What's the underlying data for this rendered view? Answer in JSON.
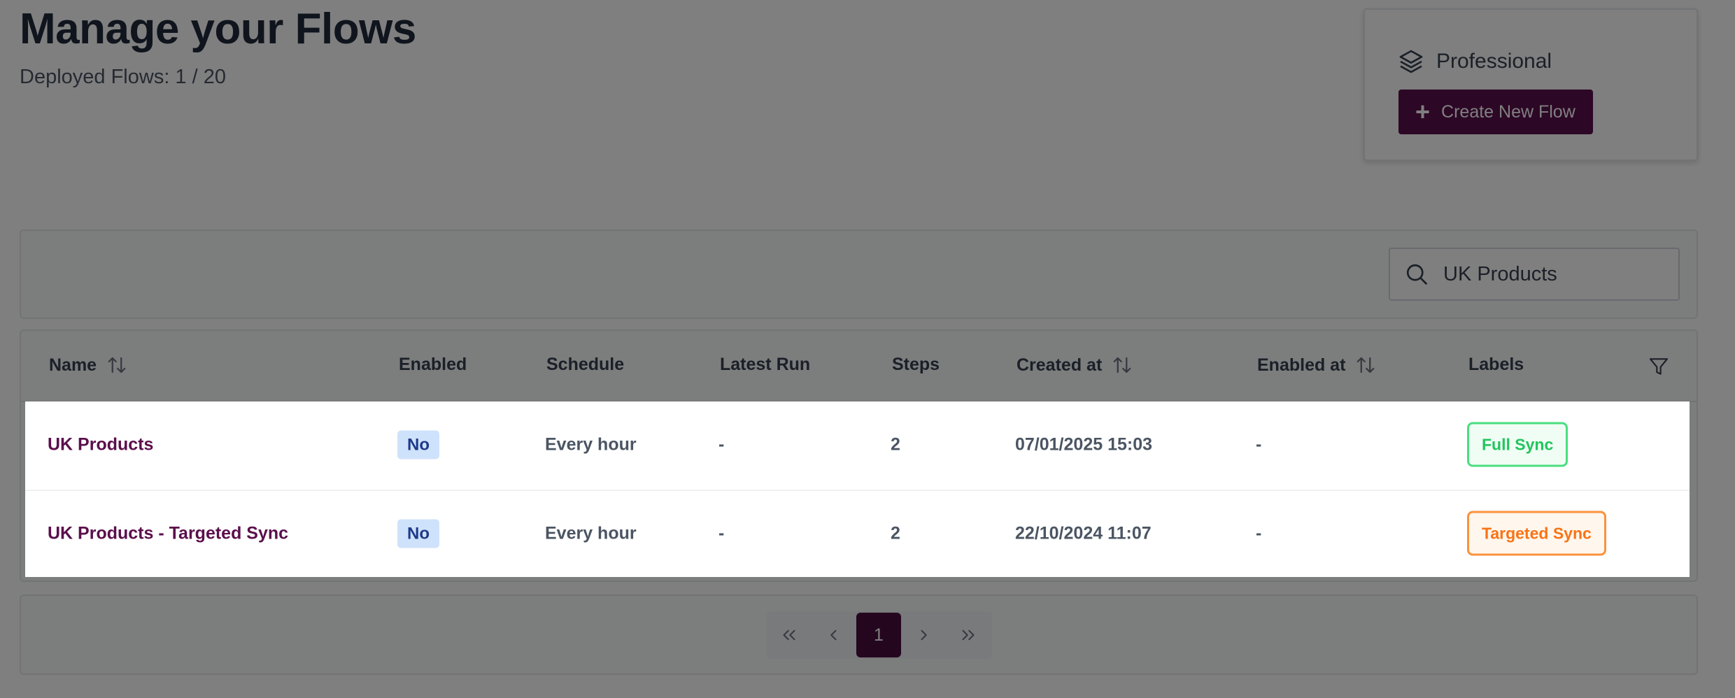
{
  "header": {
    "title": "Manage your Flows",
    "deployed": "Deployed Flows: 1 / 20"
  },
  "plan": {
    "icon": "layers-icon",
    "name": "Professional",
    "create_button": "Create New Flow"
  },
  "search": {
    "value": "UK Products",
    "icon": "search-icon"
  },
  "table": {
    "columns": [
      "Name",
      "Enabled",
      "Schedule",
      "Latest Run",
      "Steps",
      "Created at",
      "Enabled at",
      "Labels"
    ],
    "rows": [
      {
        "name": "UK Products",
        "enabled": "No",
        "schedule": "Every hour",
        "latest_run": "-",
        "steps": "2",
        "created_at": "07/01/2025 15:03",
        "enabled_at": "-",
        "label": "Full Sync"
      },
      {
        "name": "UK Products - Targeted Sync",
        "enabled": "No",
        "schedule": "Every hour",
        "latest_run": "-",
        "steps": "2",
        "created_at": "22/10/2024 11:07",
        "enabled_at": "-",
        "label": "Targeted Sync"
      }
    ]
  },
  "pagination": {
    "current_page": "1"
  },
  "colors": {
    "brand": "#5b0f4c",
    "full_sync": "#22c55e",
    "targeted_sync": "#f97316"
  }
}
